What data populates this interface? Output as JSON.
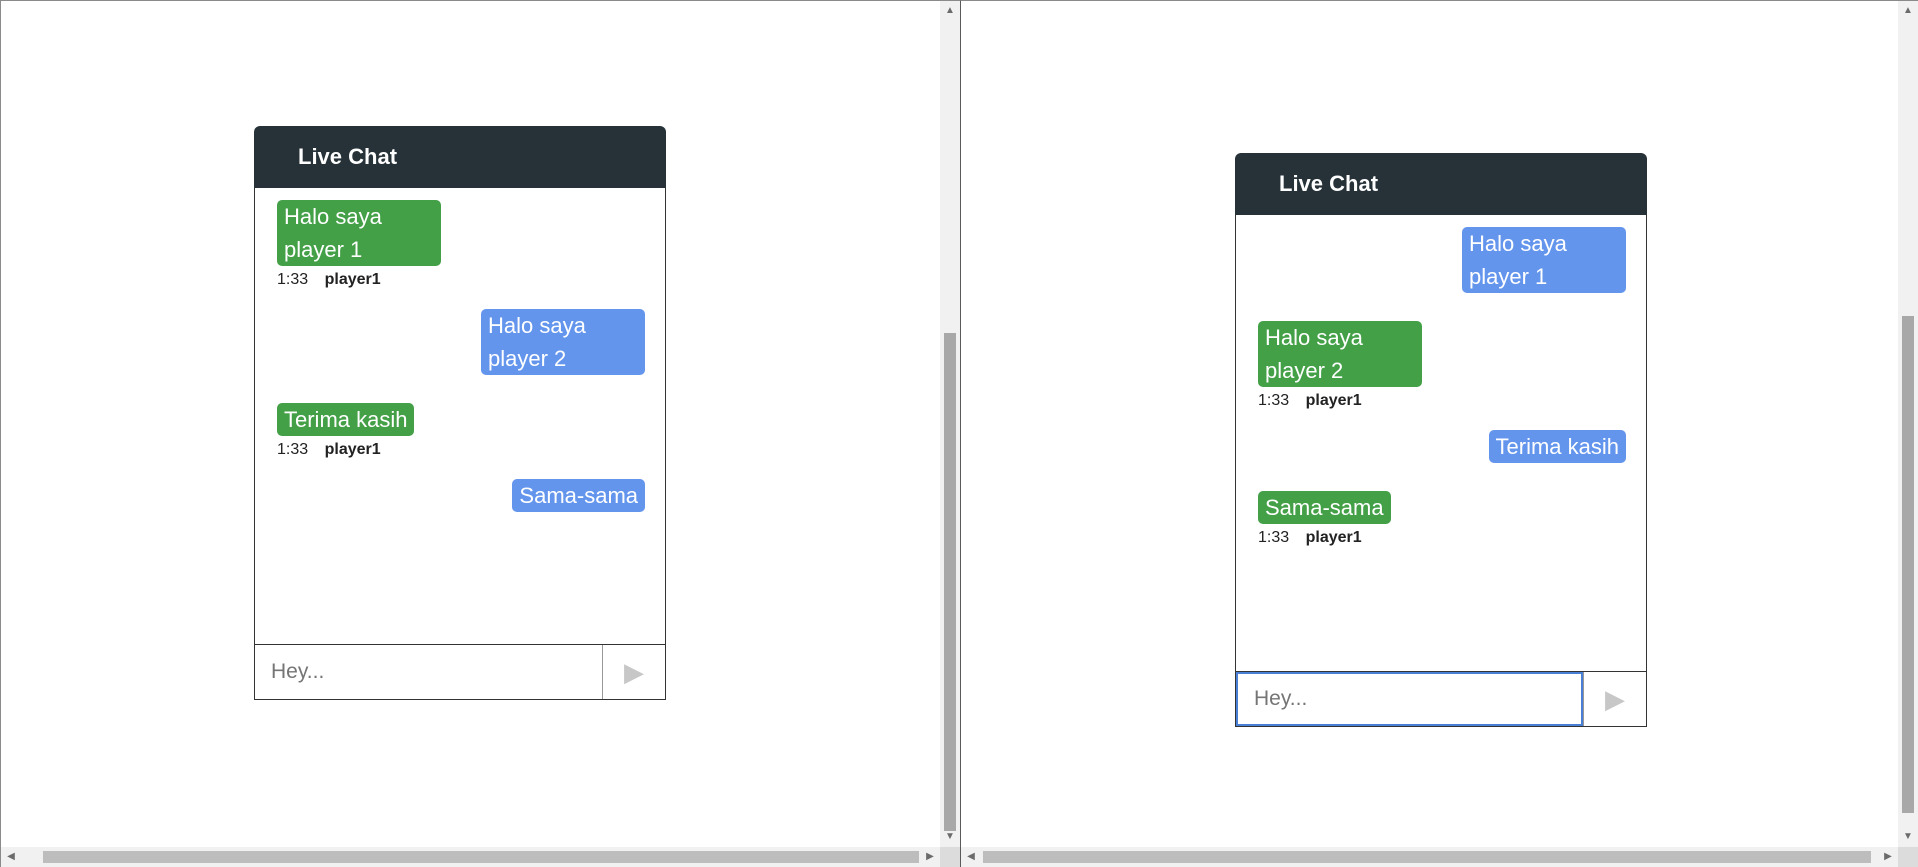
{
  "left_pane": {
    "header": "Live Chat",
    "messages": [
      {
        "side": "left",
        "color": "green",
        "text": "Halo saya player 1",
        "time": "1:33",
        "sender": "player1"
      },
      {
        "side": "right",
        "color": "blue",
        "text": "Halo saya player 2"
      },
      {
        "side": "left",
        "color": "green",
        "text": "Terima kasih",
        "time": "1:33",
        "sender": "player1"
      },
      {
        "side": "right",
        "color": "blue",
        "text": "Sama-sama"
      }
    ],
    "input_placeholder": "Hey...",
    "send_icon": "send-icon"
  },
  "right_pane": {
    "header": "Live Chat",
    "messages": [
      {
        "side": "right",
        "color": "blue",
        "text": "Halo saya player 1"
      },
      {
        "side": "left",
        "color": "green",
        "text": "Halo saya player 2",
        "time": "1:33",
        "sender": "player1"
      },
      {
        "side": "right",
        "color": "blue",
        "text": "Terima kasih"
      },
      {
        "side": "left",
        "color": "green",
        "text": "Sama-sama",
        "time": "1:33",
        "sender": "player1"
      }
    ],
    "input_placeholder": "Hey...",
    "send_icon": "send-icon"
  },
  "colors": {
    "header_bg": "#263238",
    "bubble_green": "#43a047",
    "bubble_blue": "#6495ed"
  }
}
